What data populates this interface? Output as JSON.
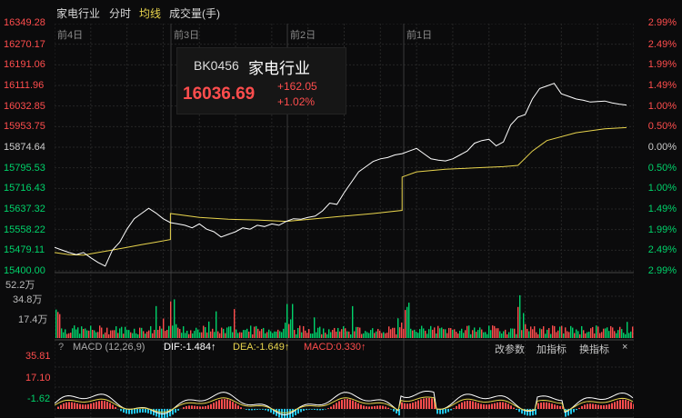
{
  "toolbar": {
    "name": "家电行业",
    "tab_fenshi": "分时",
    "tab_junxian": "均线",
    "volume_label": "成交量(手)"
  },
  "colors": {
    "up": "#ff4d4d",
    "down": "#00d26a",
    "price_line": "#ffffff",
    "avg_line": "#e8d44d",
    "dif": "#ffffff",
    "dea": "#e8d44d",
    "macd_label": "#ff4d4d",
    "bg": "#0b0b0c"
  },
  "days": [
    "前4日",
    "前3日",
    "前2日",
    "前1日"
  ],
  "price_axis": {
    "left": [
      "16349.28",
      "16270.17",
      "16191.06",
      "16111.96",
      "16032.85",
      "15953.75",
      "15874.64",
      "15795.53",
      "15716.43",
      "15637.32",
      "15558.22",
      "15479.11",
      "15400.00"
    ],
    "right": [
      "2.99%",
      "2.49%",
      "1.99%",
      "1.49%",
      "1.00%",
      "0.50%",
      "0.00%",
      "0.50%",
      "1.00%",
      "1.49%",
      "1.99%",
      "2.49%",
      "2.99%"
    ]
  },
  "info": {
    "code": "BK0456",
    "name": "家电行业",
    "price": "16036.69",
    "change": "+162.05",
    "change_pct": "+1.02%"
  },
  "volume_axis": [
    "52.2万",
    "34.8万",
    "17.4万"
  ],
  "macd": {
    "help": "?",
    "label": "MACD (12,26,9)",
    "dif": "DIF:-1.484↑",
    "dea": "DEA:-1.649↑",
    "macd": "MACD:0.330↑",
    "btn_params": "改参数",
    "btn_add": "加指标",
    "btn_switch": "换指标",
    "close": "×",
    "axis": [
      "35.81",
      "17.10",
      "-1.62"
    ]
  },
  "chart_data": {
    "type": "line",
    "title": "家电行业 分时",
    "ylim": [
      15400.0,
      16349.28
    ],
    "prev_close": 15874.64,
    "series": [
      {
        "name": "price",
        "x": [
          0,
          8,
          16,
          24,
          32,
          40,
          48,
          56,
          64,
          72,
          80,
          88,
          96,
          104,
          112,
          120,
          128,
          136,
          144,
          152,
          160,
          168,
          176,
          184,
          192,
          200,
          208,
          216,
          224,
          232,
          240,
          248,
          256,
          264,
          272,
          280,
          288,
          296,
          304,
          312,
          320,
          328,
          336,
          344,
          352,
          360,
          368,
          376,
          384,
          392,
          400,
          408,
          416,
          424,
          432,
          440,
          448,
          456,
          464,
          472,
          480,
          488,
          496,
          504,
          512,
          520,
          528,
          536,
          544,
          552,
          560,
          568,
          576,
          584,
          592,
          600,
          608,
          616,
          624,
          632
        ],
        "values": [
          15490,
          15480,
          15470,
          15462,
          15470,
          15450,
          15432,
          15418,
          15480,
          15510,
          15560,
          15600,
          15620,
          15640,
          15622,
          15600,
          15585,
          15580,
          15575,
          15565,
          15580,
          15560,
          15550,
          15530,
          15540,
          15550,
          15565,
          15560,
          15575,
          15570,
          15580,
          15575,
          15590,
          15600,
          15598,
          15605,
          15610,
          15630,
          15660,
          15655,
          15700,
          15740,
          15780,
          15800,
          15820,
          15830,
          15835,
          15845,
          15850,
          15860,
          15870,
          15850,
          15830,
          15825,
          15822,
          15830,
          15845,
          15860,
          15890,
          15900,
          15905,
          15880,
          15895,
          15960,
          15990,
          16000,
          16060,
          16100,
          16110,
          16120,
          16080,
          16070,
          16060,
          16055,
          16048,
          16050,
          16052,
          16045,
          16040,
          16036.69
        ]
      },
      {
        "name": "avg",
        "x": [
          0,
          16,
          32,
          48,
          64,
          80,
          96,
          112,
          128,
          128,
          160,
          192,
          224,
          256,
          288,
          320,
          352,
          384,
          384,
          400,
          432,
          464,
          496,
          512,
          528,
          544,
          576,
          608,
          632
        ],
        "values": [
          15470,
          15462,
          15460,
          15470,
          15480,
          15490,
          15500,
          15510,
          15520,
          15620,
          15605,
          15598,
          15595,
          15590,
          15600,
          15610,
          15620,
          15632,
          15760,
          15780,
          15790,
          15795,
          15800,
          15805,
          15860,
          15900,
          15930,
          15945,
          15950
        ]
      }
    ]
  }
}
